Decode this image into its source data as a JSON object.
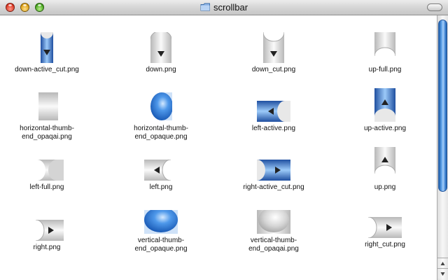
{
  "window": {
    "title": "scrollbar",
    "title_icon": "folder-icon",
    "traffic_lights": [
      "close",
      "minimize",
      "zoom"
    ],
    "accent": "#3a7fd0"
  },
  "files": [
    {
      "name": "down-active_cut.png",
      "preview": "down-active-cut"
    },
    {
      "name": "down.png",
      "preview": "down"
    },
    {
      "name": "down_cut.png",
      "preview": "down-cut"
    },
    {
      "name": "up-full.png",
      "preview": "up-full"
    },
    {
      "name": "horizontal-thumb-\nend_opaqai.png",
      "preview": "hthumb-gray"
    },
    {
      "name": "horizontal-thumb-\nend_opaque.png",
      "preview": "hthumb-blue"
    },
    {
      "name": "left-active.png",
      "preview": "left-active"
    },
    {
      "name": "up-active.png",
      "preview": "up-active"
    },
    {
      "name": "left-full.png",
      "preview": "left-full"
    },
    {
      "name": "left.png",
      "preview": "left"
    },
    {
      "name": "right-active_cut.png",
      "preview": "right-active-cut"
    },
    {
      "name": "up.png",
      "preview": "up"
    },
    {
      "name": "right.png",
      "preview": "right"
    },
    {
      "name": "vertical-thumb-\nend_opaque.png",
      "preview": "vthumb-blue"
    },
    {
      "name": "vertical-thumb-\nend_opaqai.png",
      "preview": "vthumb-gray"
    },
    {
      "name": "right_cut.png",
      "preview": "right-cut"
    }
  ],
  "scrollbar": {
    "visible_fraction": 0.66,
    "arrows": [
      "up",
      "down"
    ]
  }
}
